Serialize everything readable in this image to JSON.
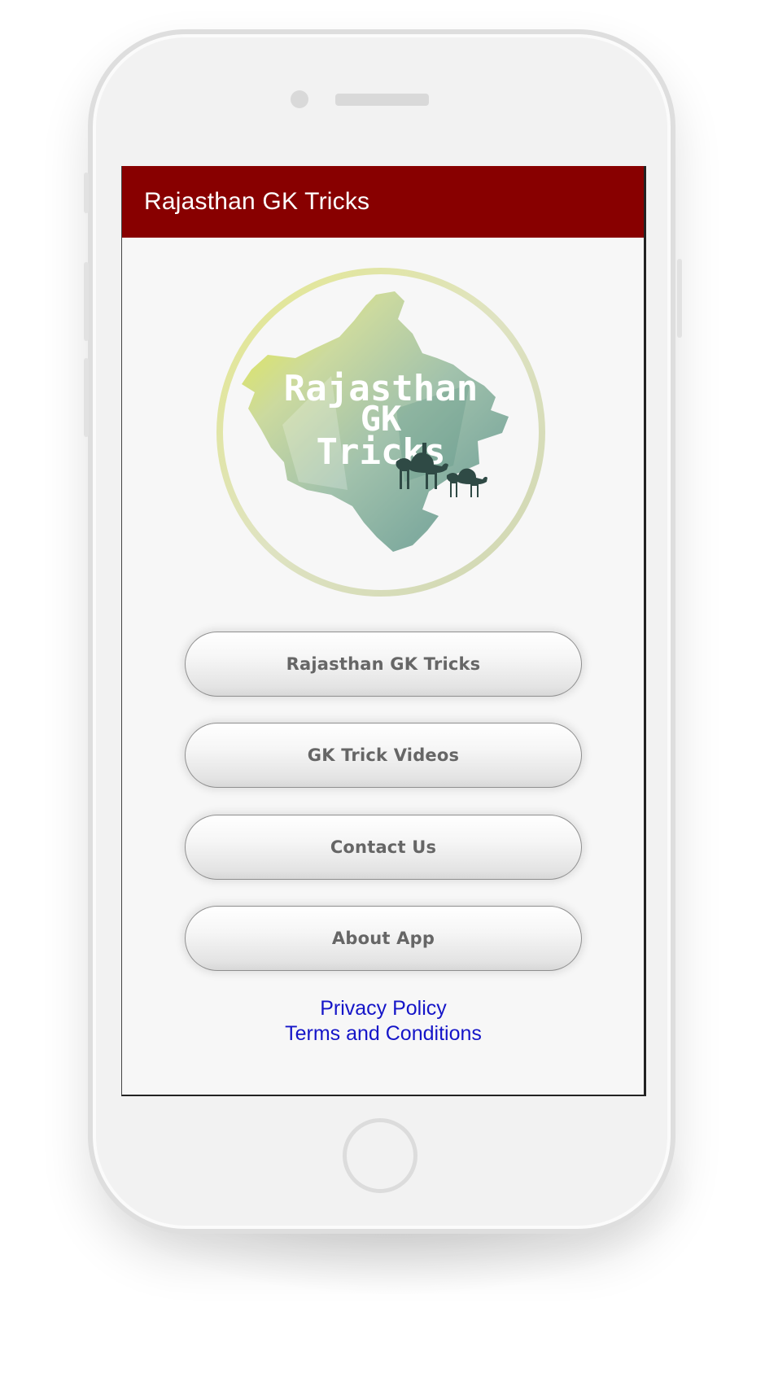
{
  "app": {
    "title": "Rajasthan GK Tricks"
  },
  "logo": {
    "line1": "Rajasthan",
    "line2": "GK",
    "line3": "Tricks"
  },
  "menu": {
    "buttons": [
      {
        "label": "Rajasthan GK Tricks"
      },
      {
        "label": "GK Trick Videos"
      },
      {
        "label": "Contact Us"
      },
      {
        "label": "About App"
      }
    ]
  },
  "footer_links": {
    "privacy": "Privacy Policy",
    "terms": "Terms and Conditions"
  },
  "colors": {
    "appbar": "#880000",
    "link": "#1515c8",
    "button_text": "#666666"
  }
}
